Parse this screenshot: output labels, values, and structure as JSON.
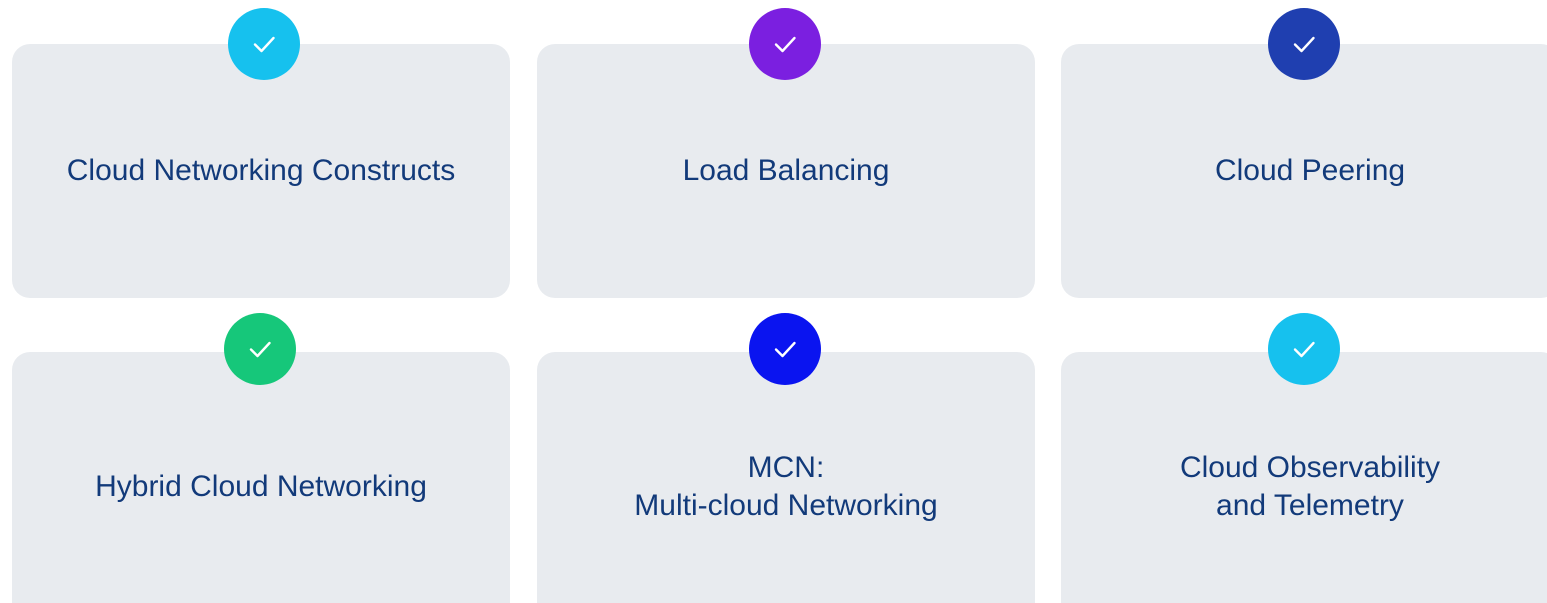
{
  "cards": [
    {
      "label": "Cloud Networking Constructs",
      "check_color": "#16c1ee",
      "icon": "check-icon"
    },
    {
      "label": "Load Balancing",
      "check_color": "#7b1fe0",
      "icon": "check-icon"
    },
    {
      "label": "Cloud Peering",
      "check_color": "#1f3fb0",
      "icon": "check-icon"
    },
    {
      "label": "Hybrid Cloud Networking",
      "check_color": "#16c77a",
      "icon": "check-icon"
    },
    {
      "label": "MCN:\nMulti-cloud Networking",
      "check_color": "#0a14f0",
      "icon": "check-icon"
    },
    {
      "label": "Cloud Observability\nand Telemetry",
      "check_color": "#16c1ee",
      "icon": "check-icon"
    }
  ],
  "colors": {
    "card_background": "#e8ebef",
    "label_text": "#123a7a"
  }
}
